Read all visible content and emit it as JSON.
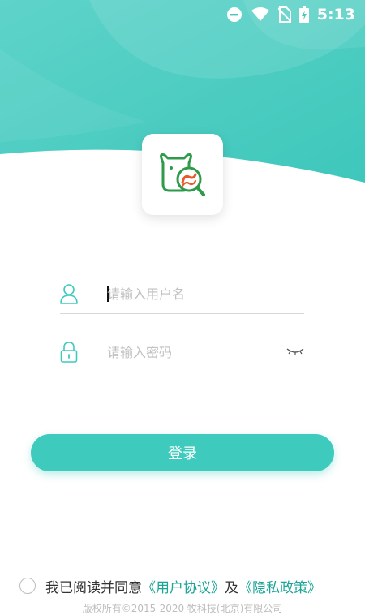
{
  "status_bar": {
    "time": "5:13"
  },
  "form": {
    "username_placeholder": "请输入用户名",
    "password_placeholder": "请输入密码",
    "login_label": "登录"
  },
  "agreement": {
    "prefix": "我已阅读并同意",
    "user_agreement": "《用户协议》",
    "conjunction": "及",
    "privacy_policy": "《隐私政策》"
  },
  "footer": {
    "copyright": "版权所有©2015-2020 牧科技(北京)有限公司"
  },
  "colors": {
    "accent": "#3ecbbd",
    "link": "#1aa596",
    "logo_green": "#2e9a4a",
    "logo_orange": "#e85a2a"
  },
  "icons": [
    "minus-circle-icon",
    "wifi-icon",
    "no-sim-icon",
    "battery-icon",
    "user-icon",
    "lock-icon",
    "eye-closed-icon",
    "cow-search-logo"
  ]
}
